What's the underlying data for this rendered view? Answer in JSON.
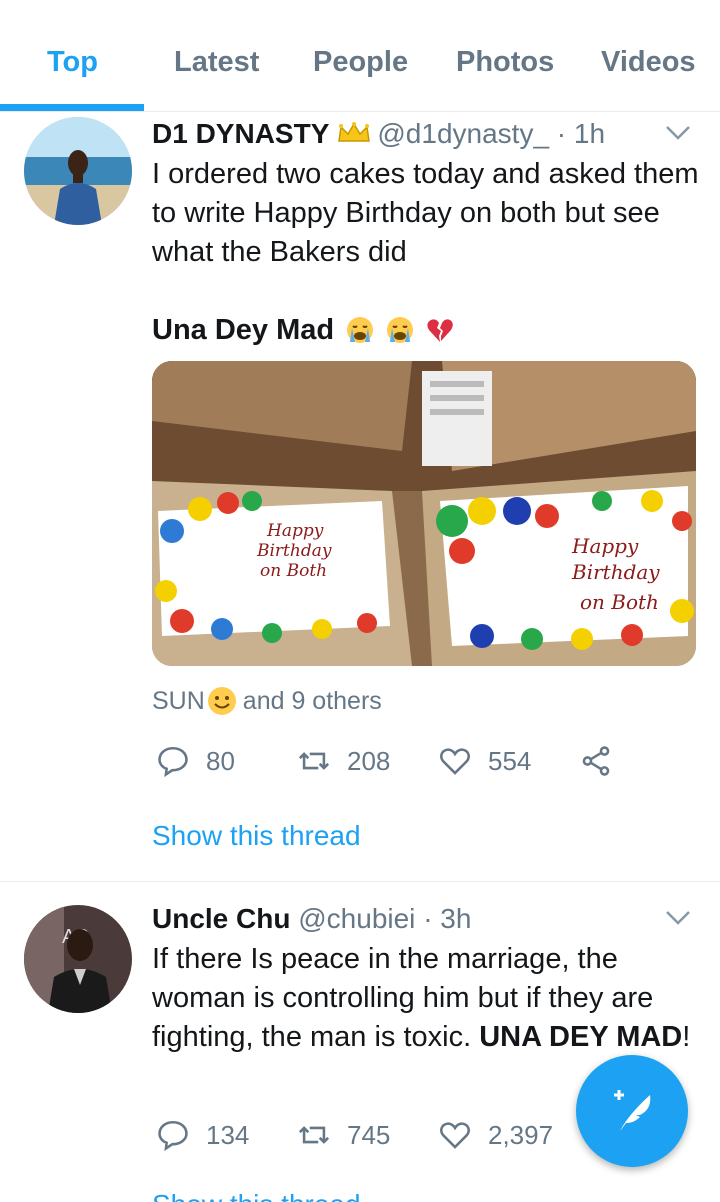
{
  "tabs": [
    {
      "label": "Top",
      "active": true
    },
    {
      "label": "Latest",
      "active": false
    },
    {
      "label": "People",
      "active": false
    },
    {
      "label": "Photos",
      "active": false
    },
    {
      "label": "Videos",
      "active": false
    }
  ],
  "tweets": [
    {
      "name": "D1 DYNASTY",
      "badge_icon": "crown-icon",
      "handle": "@d1dynasty_",
      "time": "· 1h",
      "text": "I ordered two cakes today and asked them to write Happy Birthday on both but see what the Bakers did",
      "text2": "Una Dey Mad",
      "text2_emojis": [
        "crying-face-icon",
        "crying-face-icon",
        "broken-heart-icon"
      ],
      "media_alt_icon": "cake-photo",
      "cake_left_text": "Happy Birthday on Both",
      "cake_right_text": "Happy Birthday on Both",
      "liked_by": "SUN",
      "liked_by_suffix": "and 9 others",
      "replies": "80",
      "retweets": "208",
      "likes": "554",
      "show_thread": "Show this thread"
    },
    {
      "name": "Uncle Chu",
      "handle": "@chubiei",
      "time": "· 3h",
      "text_plain": "If there Is peace in the marriage, the woman is controlling him but if they are fighting, the man is toxic. ",
      "text_bold": "UNA DEY MAD",
      "text_end": "!",
      "replies": "134",
      "retweets": "745",
      "likes": "2,397",
      "show_thread": "Show this thread"
    }
  ],
  "colors": {
    "accent": "#1da1f2",
    "muted": "#657786",
    "text": "#14171a",
    "divider": "#e6ecf0"
  }
}
